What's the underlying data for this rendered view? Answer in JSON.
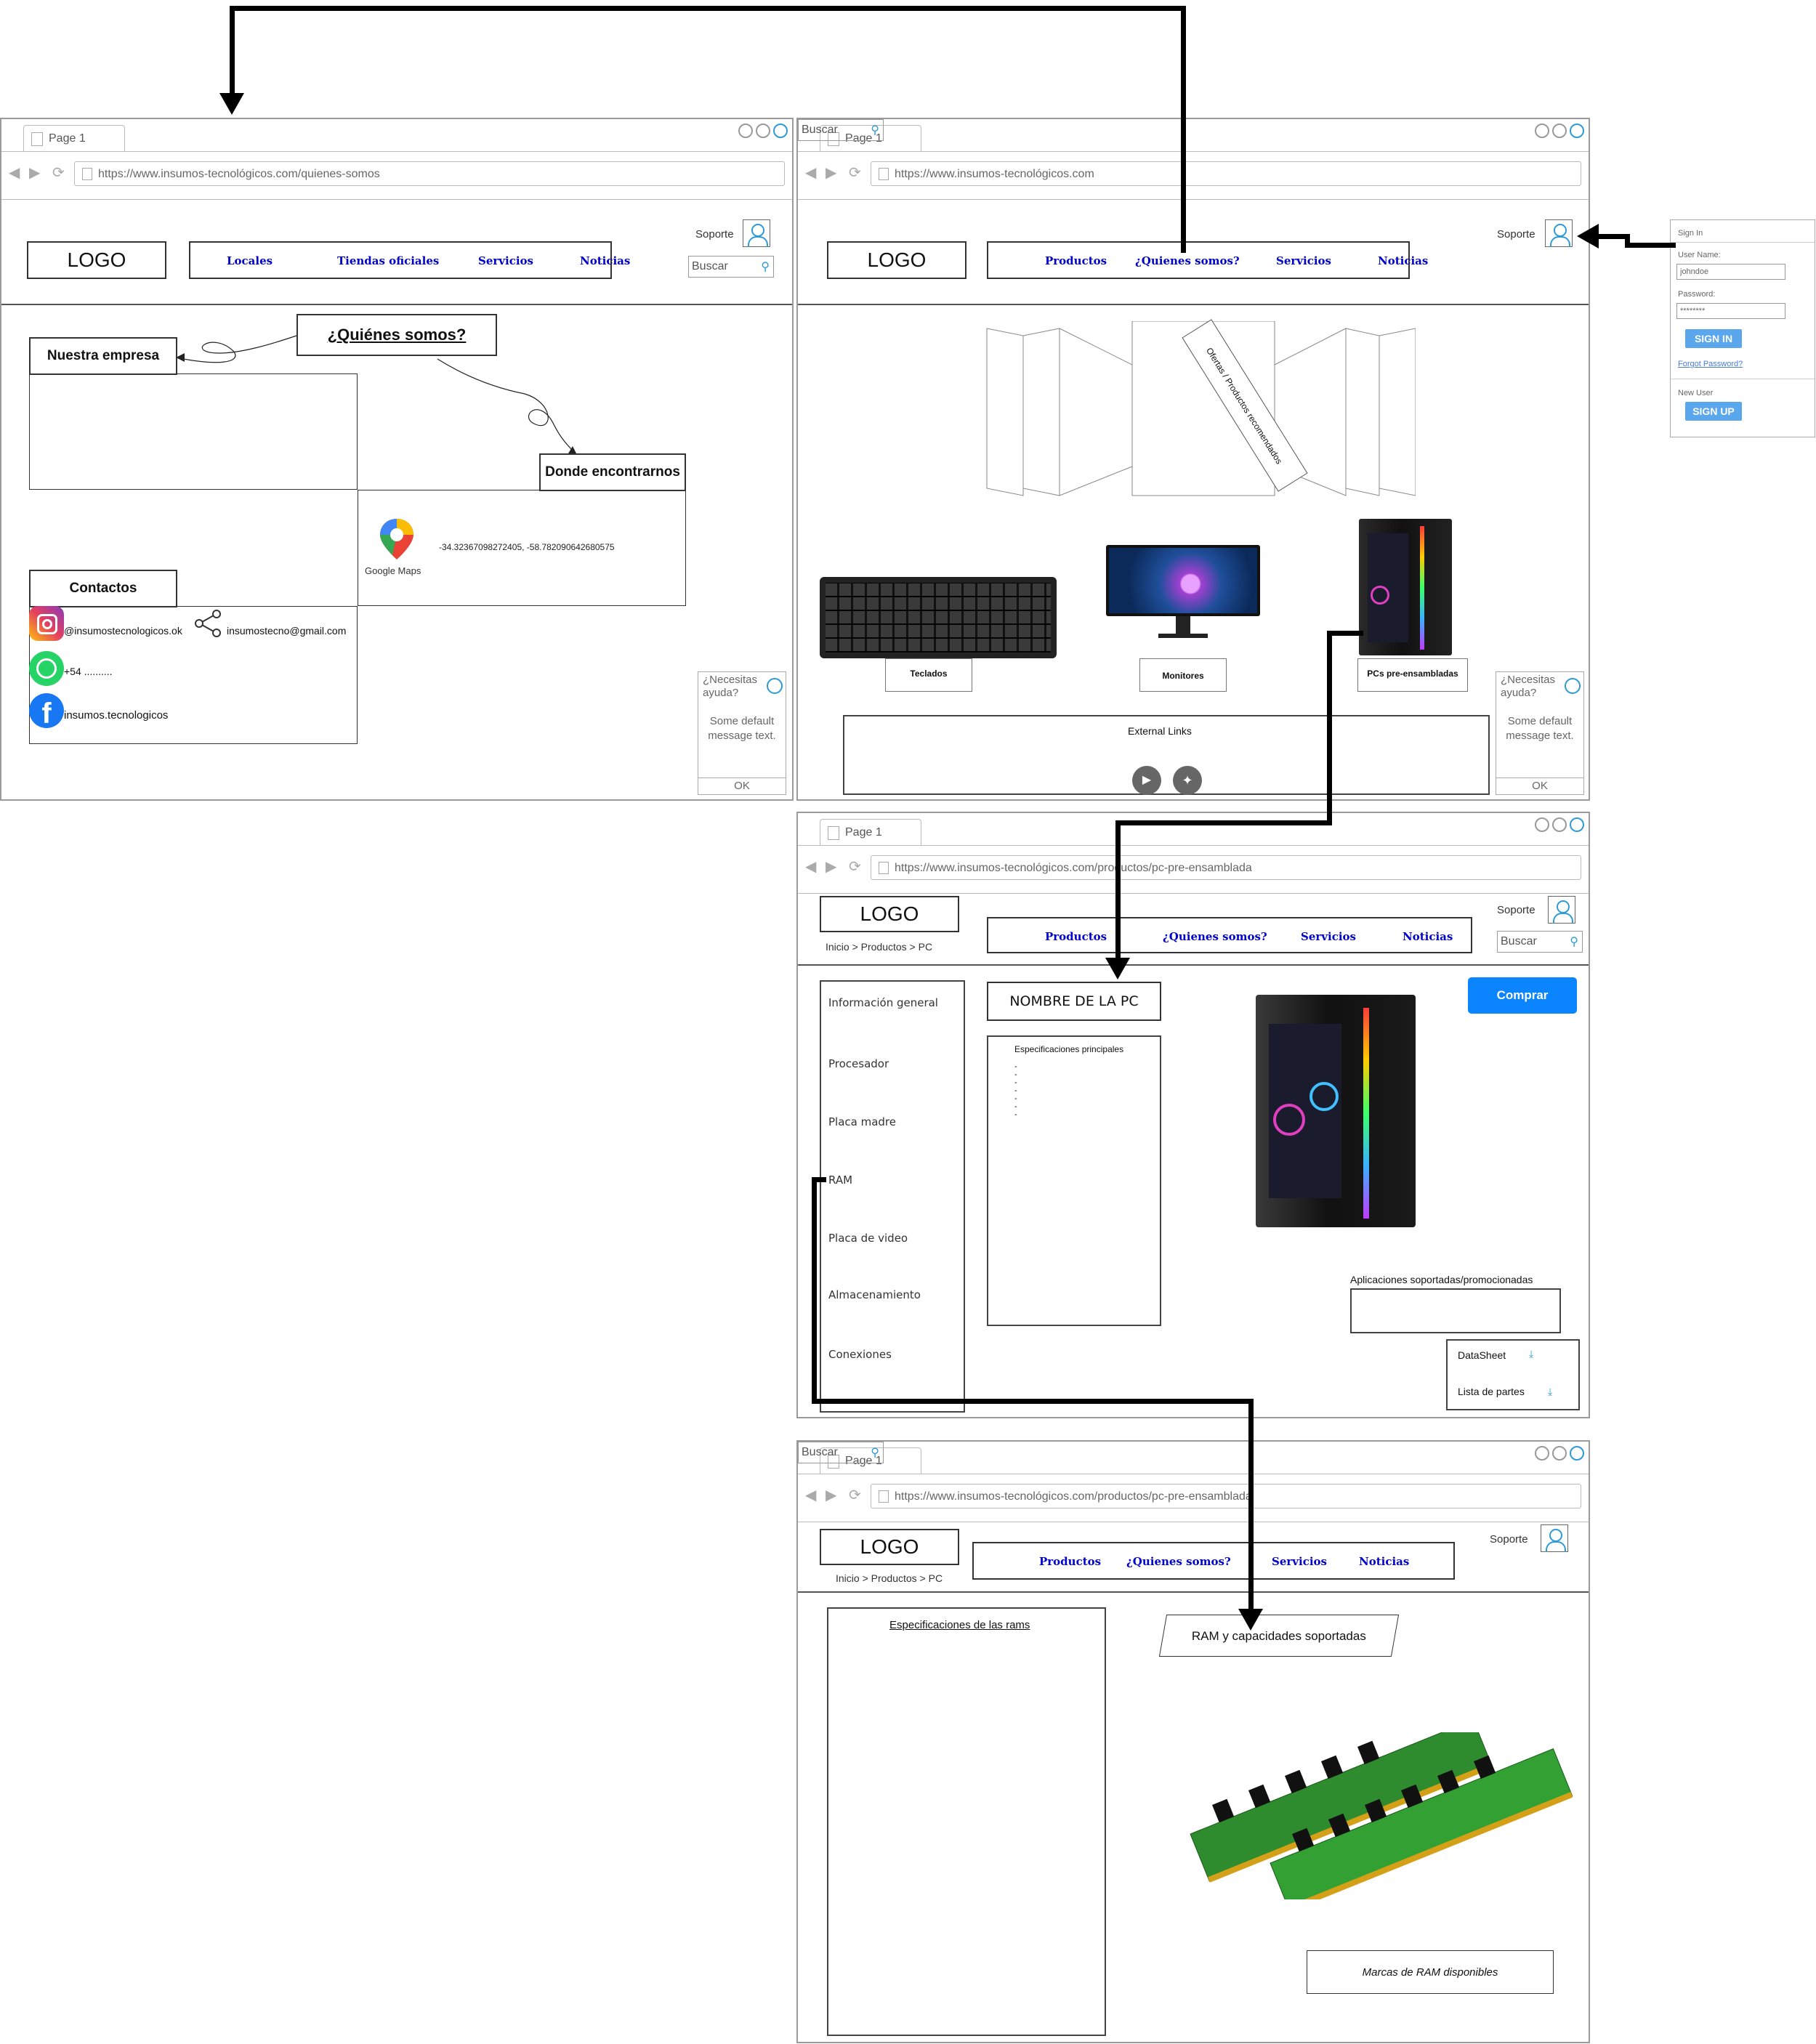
{
  "common": {
    "tab": "Page 1",
    "logo": "LOGO",
    "soporte": "Soporte",
    "buscar": "Buscar",
    "help_title": "¿Necesitas ayuda?",
    "help_msg": "Some default message text.",
    "help_ok": "OK"
  },
  "w1": {
    "url": "https://www.insumos-tecnológicos.com/quienes-somos",
    "menu": [
      "Locales",
      "Tiendas oficiales",
      "Servicios",
      "Noticias"
    ],
    "quienes": "¿Quiénes somos?",
    "nuestra": "Nuestra empresa",
    "donde": "Donde encontrarnos",
    "maps_label": "Google Maps",
    "coords": "-34.32367098272405, -58.782090642680575",
    "contactos": "Contactos",
    "instagram": "@insumostecnologicos.ok",
    "email": "insumostecno@gmail.com",
    "whatsapp": "+54 ..........",
    "facebook": "insumos.tecnologicos"
  },
  "w2": {
    "url": "https://www.insumos-tecnológicos.com",
    "menu": [
      "Productos",
      "¿Quienes somos?",
      "Servicios",
      "Noticias"
    ],
    "carousel": "Ofertas / Productos recomendados",
    "teclados": "Teclados",
    "monitores": "Monitores",
    "pcs": "PCs pre-ensambladas",
    "external": "External Links"
  },
  "signin": {
    "title": "Sign In",
    "user_label": "User Name:",
    "user_value": "johndoe",
    "pass_label": "Password:",
    "pass_value": "********",
    "signin_btn": "SIGN IN",
    "forgot": "Forgot Password?",
    "new_user": "New User",
    "signup_btn": "SIGN UP"
  },
  "w3": {
    "url": "https://www.insumos-tecnológicos.com/productos/pc-pre-ensamblada",
    "breadcrumb": "Inicio > Productos > PC",
    "menu": [
      "Productos",
      "¿Quienes somos?",
      "Servicios",
      "Noticias"
    ],
    "side": [
      "Información general",
      "Procesador",
      "Placa madre",
      "RAM",
      "Placa de video",
      "Almacenamiento",
      "Conexiones"
    ],
    "nombre": "NOMBRE DE LA PC",
    "espec": "Especificaciones principales",
    "bullets": "-\n-\n-\n-\n-\n-\n-",
    "comprar": "Comprar",
    "apps": "Aplicaciones soportadas/promocionadas",
    "datasheet": "DataSheet",
    "lista": "Lista de partes"
  },
  "w4": {
    "url": "https://www.insumos-tecnológicos.com/productos/pc-pre-ensamblada",
    "breadcrumb": "Inicio > Productos > PC",
    "menu": [
      "Productos",
      "¿Quienes somos?",
      "Servicios",
      "Noticias"
    ],
    "espec_rams": "Especificaciones de las rams",
    "ram_cap": "RAM y capacidades soportadas",
    "marcas": "Marcas de RAM disponibles"
  },
  "colors": {
    "link": "#0000cc",
    "accent": "#2f9bd6",
    "buy": "#0a84ff"
  }
}
